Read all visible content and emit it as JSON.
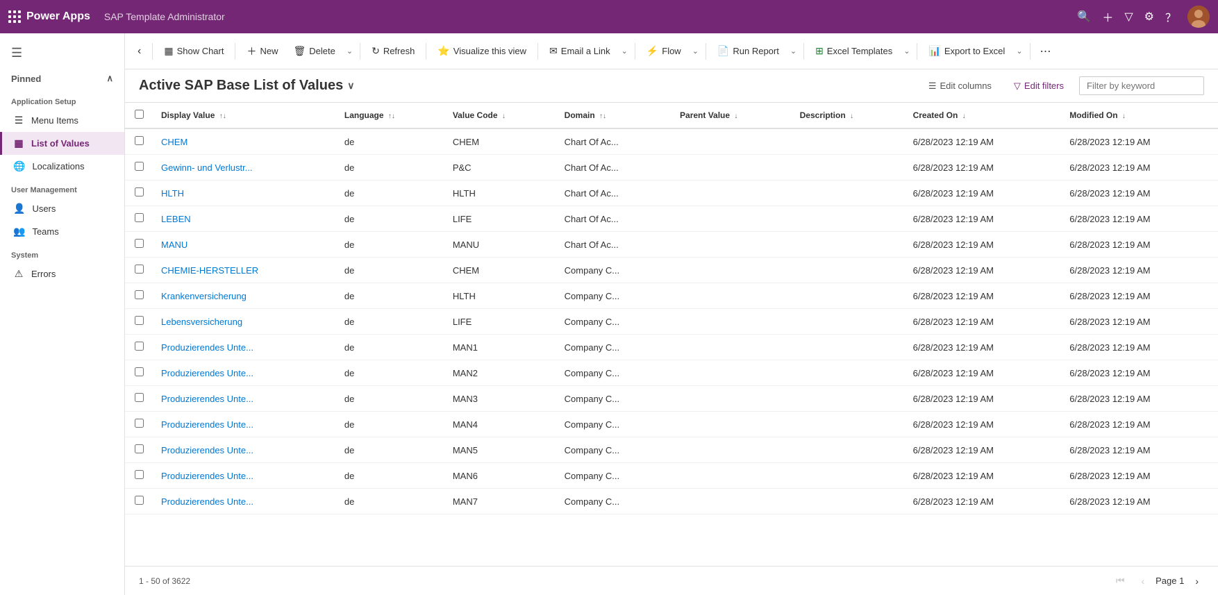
{
  "topbar": {
    "app_name": "Power Apps",
    "page_title": "SAP Template Administrator"
  },
  "toolbar": {
    "back_label": "‹",
    "show_chart": "Show Chart",
    "new": "New",
    "delete": "Delete",
    "refresh": "Refresh",
    "visualize": "Visualize this view",
    "email_link": "Email a Link",
    "flow": "Flow",
    "run_report": "Run Report",
    "excel_templates": "Excel Templates",
    "export_to_excel": "Export to Excel",
    "more": "⋯"
  },
  "list_view": {
    "title": "Active SAP Base List of Values",
    "edit_columns": "Edit columns",
    "edit_filters": "Edit filters",
    "filter_placeholder": "Filter by keyword"
  },
  "columns": [
    {
      "label": "Display Value",
      "sort": "↑↓"
    },
    {
      "label": "Language",
      "sort": "↑↓"
    },
    {
      "label": "Value Code",
      "sort": "↓"
    },
    {
      "label": "Domain",
      "sort": "↑↓"
    },
    {
      "label": "Parent Value",
      "sort": "↓"
    },
    {
      "label": "Description",
      "sort": "↓"
    },
    {
      "label": "Created On",
      "sort": "↓"
    },
    {
      "label": "Modified On",
      "sort": "↓"
    }
  ],
  "rows": [
    {
      "display_value": "CHEM",
      "language": "de",
      "value_code": "CHEM",
      "domain": "Chart Of Ac...",
      "parent_value": "",
      "description": "",
      "created_on": "6/28/2023 12:19 AM",
      "modified_on": "6/28/2023 12:19 AM"
    },
    {
      "display_value": "Gewinn- und Verlustr...",
      "language": "de",
      "value_code": "P&C",
      "domain": "Chart Of Ac...",
      "parent_value": "",
      "description": "",
      "created_on": "6/28/2023 12:19 AM",
      "modified_on": "6/28/2023 12:19 AM"
    },
    {
      "display_value": "HLTH",
      "language": "de",
      "value_code": "HLTH",
      "domain": "Chart Of Ac...",
      "parent_value": "",
      "description": "",
      "created_on": "6/28/2023 12:19 AM",
      "modified_on": "6/28/2023 12:19 AM"
    },
    {
      "display_value": "LEBEN",
      "language": "de",
      "value_code": "LIFE",
      "domain": "Chart Of Ac...",
      "parent_value": "",
      "description": "",
      "created_on": "6/28/2023 12:19 AM",
      "modified_on": "6/28/2023 12:19 AM"
    },
    {
      "display_value": "MANU",
      "language": "de",
      "value_code": "MANU",
      "domain": "Chart Of Ac...",
      "parent_value": "",
      "description": "",
      "created_on": "6/28/2023 12:19 AM",
      "modified_on": "6/28/2023 12:19 AM"
    },
    {
      "display_value": "CHEMIE-HERSTELLER",
      "language": "de",
      "value_code": "CHEM",
      "domain": "Company C...",
      "parent_value": "",
      "description": "",
      "created_on": "6/28/2023 12:19 AM",
      "modified_on": "6/28/2023 12:19 AM"
    },
    {
      "display_value": "Krankenversicherung",
      "language": "de",
      "value_code": "HLTH",
      "domain": "Company C...",
      "parent_value": "",
      "description": "",
      "created_on": "6/28/2023 12:19 AM",
      "modified_on": "6/28/2023 12:19 AM"
    },
    {
      "display_value": "Lebensversicherung",
      "language": "de",
      "value_code": "LIFE",
      "domain": "Company C...",
      "parent_value": "",
      "description": "",
      "created_on": "6/28/2023 12:19 AM",
      "modified_on": "6/28/2023 12:19 AM"
    },
    {
      "display_value": "Produzierendes Unte...",
      "language": "de",
      "value_code": "MAN1",
      "domain": "Company C...",
      "parent_value": "",
      "description": "",
      "created_on": "6/28/2023 12:19 AM",
      "modified_on": "6/28/2023 12:19 AM"
    },
    {
      "display_value": "Produzierendes Unte...",
      "language": "de",
      "value_code": "MAN2",
      "domain": "Company C...",
      "parent_value": "",
      "description": "",
      "created_on": "6/28/2023 12:19 AM",
      "modified_on": "6/28/2023 12:19 AM"
    },
    {
      "display_value": "Produzierendes Unte...",
      "language": "de",
      "value_code": "MAN3",
      "domain": "Company C...",
      "parent_value": "",
      "description": "",
      "created_on": "6/28/2023 12:19 AM",
      "modified_on": "6/28/2023 12:19 AM"
    },
    {
      "display_value": "Produzierendes Unte...",
      "language": "de",
      "value_code": "MAN4",
      "domain": "Company C...",
      "parent_value": "",
      "description": "",
      "created_on": "6/28/2023 12:19 AM",
      "modified_on": "6/28/2023 12:19 AM"
    },
    {
      "display_value": "Produzierendes Unte...",
      "language": "de",
      "value_code": "MAN5",
      "domain": "Company C...",
      "parent_value": "",
      "description": "",
      "created_on": "6/28/2023 12:19 AM",
      "modified_on": "6/28/2023 12:19 AM"
    },
    {
      "display_value": "Produzierendes Unte...",
      "language": "de",
      "value_code": "MAN6",
      "domain": "Company C...",
      "parent_value": "",
      "description": "",
      "created_on": "6/28/2023 12:19 AM",
      "modified_on": "6/28/2023 12:19 AM"
    },
    {
      "display_value": "Produzierendes Unte...",
      "language": "de",
      "value_code": "MAN7",
      "domain": "Company C...",
      "parent_value": "",
      "description": "",
      "created_on": "6/28/2023 12:19 AM",
      "modified_on": "6/28/2023 12:19 AM"
    }
  ],
  "footer": {
    "record_count": "1 - 50 of 3622",
    "page_label": "Page 1"
  },
  "sidebar": {
    "pinned": "Pinned",
    "sections": [
      {
        "title": "Application Setup",
        "items": [
          {
            "label": "Menu Items",
            "icon": "☰",
            "active": false
          },
          {
            "label": "List of Values",
            "icon": "▦",
            "active": true
          },
          {
            "label": "Localizations",
            "icon": "🌐",
            "active": false
          }
        ]
      },
      {
        "title": "User Management",
        "items": [
          {
            "label": "Users",
            "icon": "👤",
            "active": false
          },
          {
            "label": "Teams",
            "icon": "👥",
            "active": false
          }
        ]
      },
      {
        "title": "System",
        "items": [
          {
            "label": "Errors",
            "icon": "⚠",
            "active": false
          }
        ]
      }
    ]
  }
}
